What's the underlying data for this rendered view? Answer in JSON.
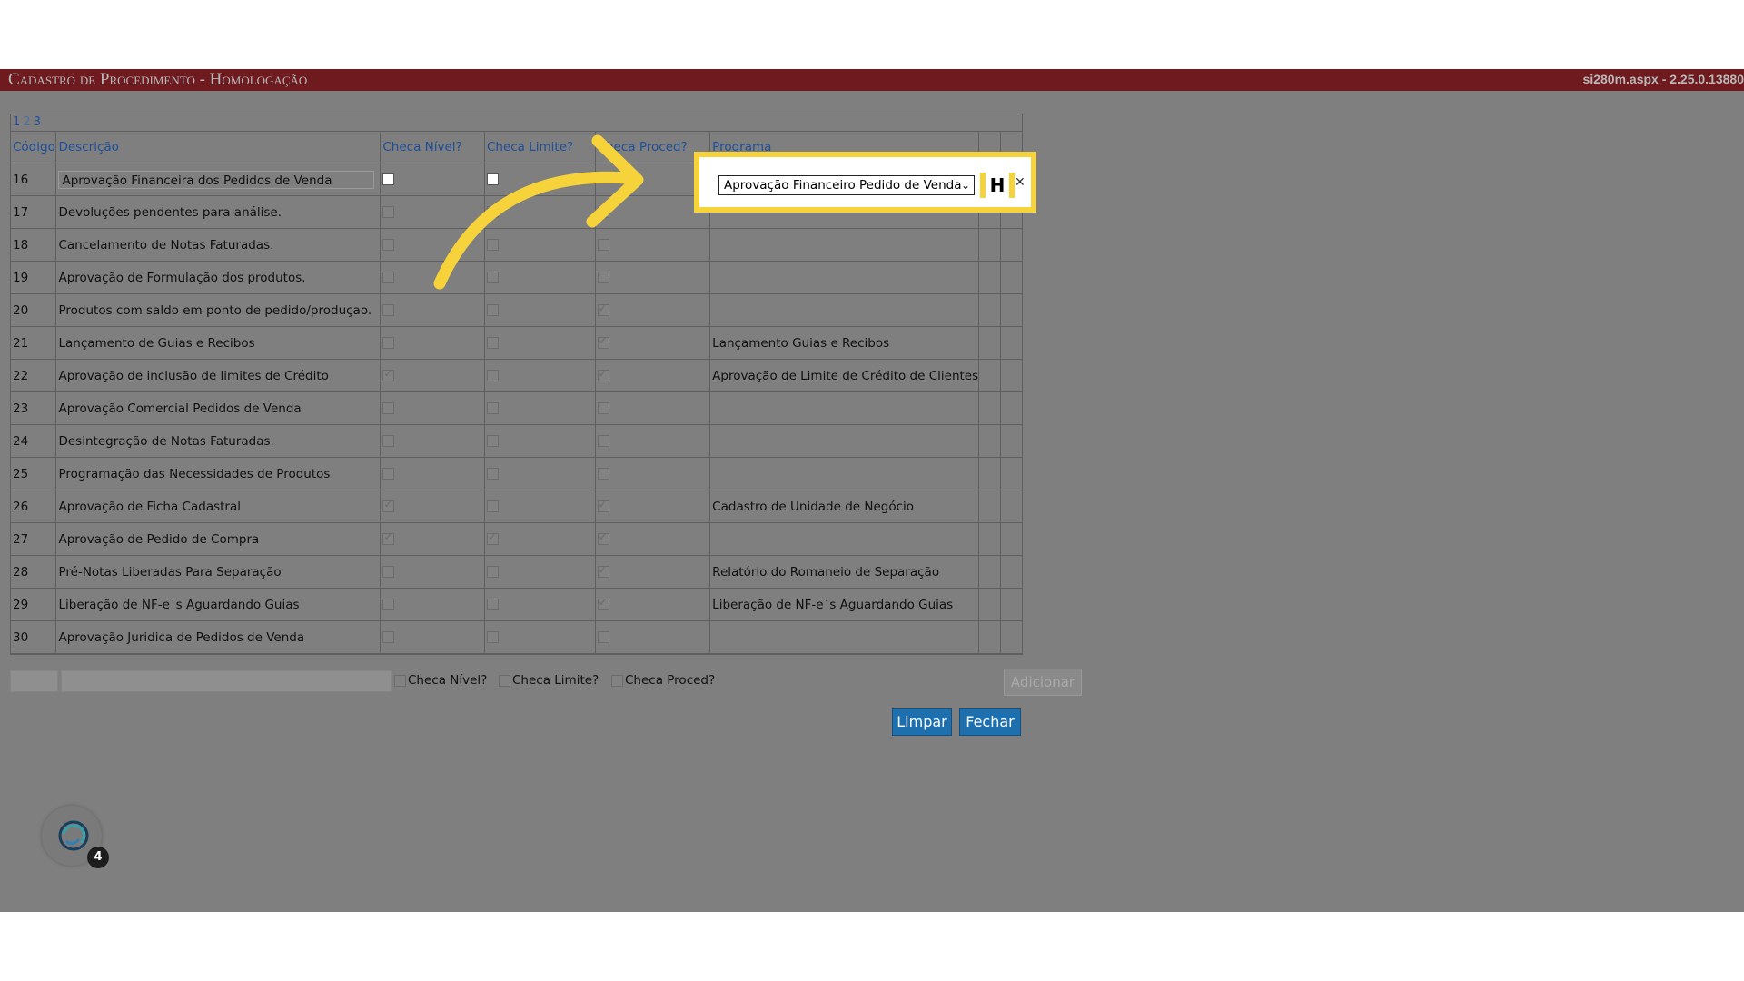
{
  "window": {
    "title": "Cadastro de Procedimento  - Homologação",
    "version": "si280m.aspx - 2.25.0.13880"
  },
  "pager": {
    "pages": [
      "1",
      "2",
      "3"
    ],
    "current": "2"
  },
  "table": {
    "columns": [
      "Código",
      "Descrição",
      "Checa Nível?",
      "Checa Limite?",
      "Checa Proced?",
      "Programa"
    ],
    "edit_row": {
      "code": "16",
      "description": "Aprovação Financeira dos Pedidos de Venda",
      "program_selected": "Aprovação Financeiro Pedido de Venda"
    },
    "rows": [
      {
        "code": "17",
        "description": "Devoluções pendentes para análise.",
        "nivel": false,
        "limite": false,
        "proced": false,
        "program": ""
      },
      {
        "code": "18",
        "description": "Cancelamento de Notas Faturadas.",
        "nivel": false,
        "limite": false,
        "proced": false,
        "program": ""
      },
      {
        "code": "19",
        "description": "Aprovação de Formulação dos produtos.",
        "nivel": false,
        "limite": false,
        "proced": false,
        "program": ""
      },
      {
        "code": "20",
        "description": "Produtos com saldo em ponto de pedido/produçao.",
        "nivel": false,
        "limite": false,
        "proced": true,
        "program": ""
      },
      {
        "code": "21",
        "description": "Lançamento de Guias e Recibos",
        "nivel": false,
        "limite": false,
        "proced": true,
        "program": "Lançamento Guias e Recibos"
      },
      {
        "code": "22",
        "description": "Aprovação de inclusão de limites de Crédito",
        "nivel": true,
        "limite": false,
        "proced": true,
        "program": "Aprovação de Limite de Crédito de Clientes"
      },
      {
        "code": "23",
        "description": "Aprovação Comercial Pedidos de Venda",
        "nivel": false,
        "limite": false,
        "proced": false,
        "program": ""
      },
      {
        "code": "24",
        "description": "Desintegração de Notas Faturadas.",
        "nivel": false,
        "limite": false,
        "proced": false,
        "program": ""
      },
      {
        "code": "25",
        "description": "Programação das Necessidades de Produtos",
        "nivel": false,
        "limite": false,
        "proced": false,
        "program": ""
      },
      {
        "code": "26",
        "description": "Aprovação de Ficha Cadastral",
        "nivel": true,
        "limite": false,
        "proced": true,
        "program": "Cadastro de Unidade de Negócio"
      },
      {
        "code": "27",
        "description": "Aprovação de Pedido de Compra",
        "nivel": true,
        "limite": true,
        "proced": true,
        "program": ""
      },
      {
        "code": "28",
        "description": "Pré-Notas Liberadas Para Separação",
        "nivel": false,
        "limite": false,
        "proced": true,
        "program": "Relatório do Romaneio de Separação"
      },
      {
        "code": "29",
        "description": "Liberação de NF-e´s Aguardando Guias",
        "nivel": false,
        "limite": false,
        "proced": true,
        "program": "Liberação de NF-e´s Aguardando Guias"
      },
      {
        "code": "30",
        "description": "Aprovação Juridica de Pedidos de Venda",
        "nivel": false,
        "limite": false,
        "proced": false,
        "program": ""
      }
    ]
  },
  "footer": {
    "checa_nivel": "Checa Nível?",
    "checa_limite": "Checa Limite?",
    "checa_proced": "Checa Proced?",
    "add_label": "Adicionar",
    "clear_label": "Limpar",
    "close_label": "Fechar"
  },
  "badge": {
    "count": "4"
  },
  "colors": {
    "titlebar": "#6e1a1f",
    "overlay": "#7f7f7f",
    "highlight": "#f6d33a",
    "button": "#1e6fae",
    "header_text": "#1d4f9a"
  }
}
